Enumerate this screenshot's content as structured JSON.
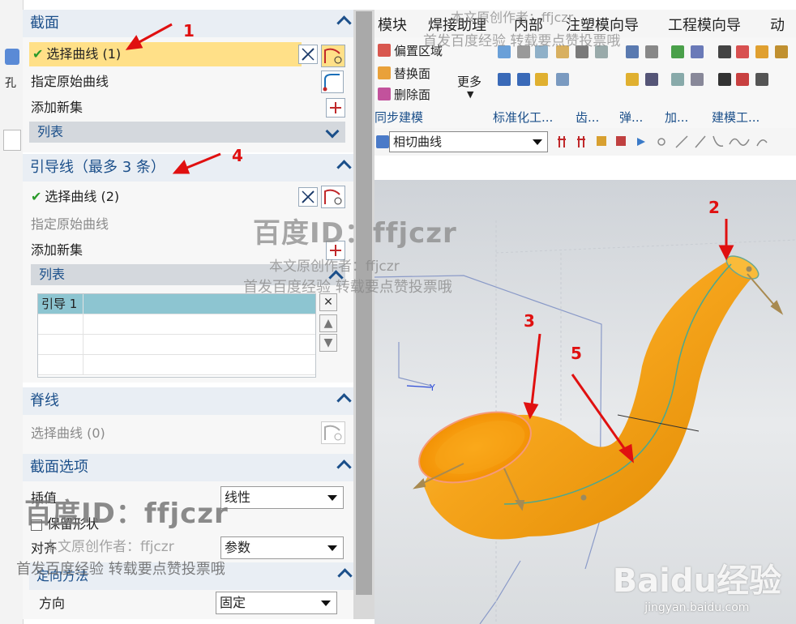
{
  "main": {
    "left_label": "孔",
    "menu": [
      "模块",
      "焊接助理",
      "内部",
      "注塑模向导",
      "工程模向导",
      "动"
    ],
    "ribbon": {
      "items": [
        "偏置区域",
        "替换面",
        "删除面",
        "更多"
      ],
      "groups": [
        "同步建模",
        "标准化工...",
        "齿...",
        "弹...",
        "加...",
        "建模工..."
      ]
    },
    "filter": {
      "curve_rule": "相切曲线"
    }
  },
  "dialog": {
    "section": {
      "title": "截面",
      "select_curve": "选择曲线 (1)",
      "specify_origin": "指定原始曲线",
      "add_new_set": "添加新集",
      "list": "列表"
    },
    "guide": {
      "title": "引导线（最多 3 条）",
      "select_curve": "选择曲线 (2)",
      "specify_origin": "指定原始曲线",
      "add_new_set": "添加新集",
      "list": "列表",
      "rows": [
        "引导 1",
        "",
        "",
        ""
      ]
    },
    "spine": {
      "title": "脊线",
      "select_curve": "选择曲线 (0)"
    },
    "section_options": {
      "title": "截面选项",
      "interp_label": "插值",
      "interp_value": "线性",
      "keep_shape": "保留形状",
      "align_label": "对齐",
      "align_value": "参数",
      "orient_title": "定向方法",
      "direction_label": "方向",
      "direction_value": "固定"
    }
  },
  "annotations": {
    "numbers": [
      "1",
      "2",
      "3",
      "4",
      "5"
    ]
  },
  "watermarks": {
    "id_text": "百度ID：ffjczr",
    "author_line": "本文原创作者：ffjczr",
    "share_line": "首发百度经验 转载要点赞投票哦",
    "author_line_top": "本文原创作者：ffjczr",
    "share_line_top": "首发百度经验 转载要点赞投票哦"
  },
  "brand": {
    "logo": "Baidu经验",
    "url": "jingyan.baidu.com"
  },
  "colors": {
    "accent": "#1b4f8a",
    "selection": "#ffe088",
    "pipe": "#f3a21a",
    "annotation": "#e01010"
  }
}
